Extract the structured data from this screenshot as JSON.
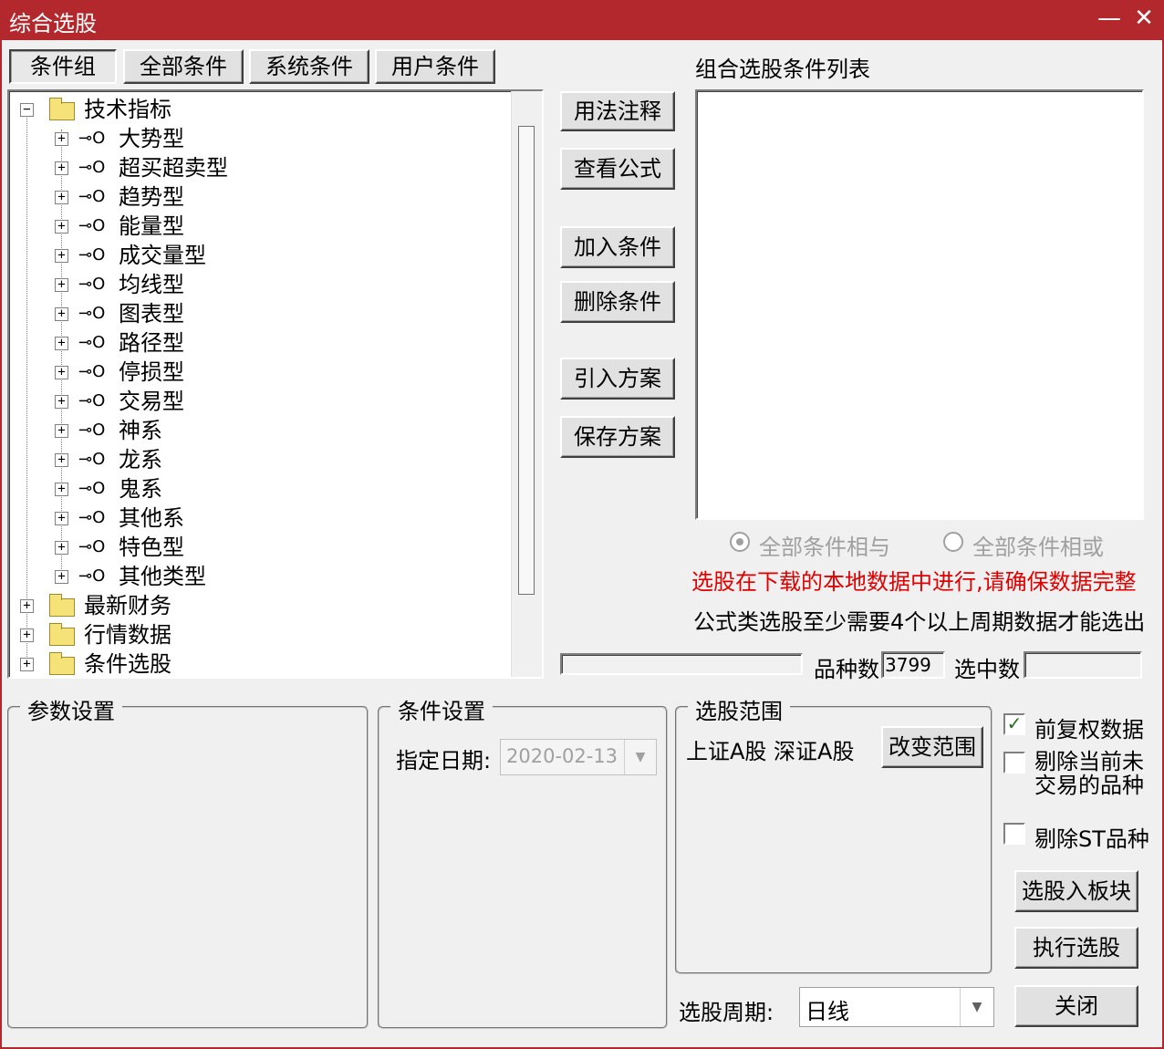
{
  "window": {
    "title": "综合选股",
    "minimize_glyph": "—",
    "close_glyph": "✕"
  },
  "tabs": [
    "条件组",
    "全部条件",
    "系统条件",
    "用户条件"
  ],
  "tree": {
    "root": "技术指标",
    "children": [
      "大势型",
      "超买超卖型",
      "趋势型",
      "能量型",
      "成交量型",
      "均线型",
      "图表型",
      "路径型",
      "停损型",
      "交易型",
      "神系",
      "龙系",
      "鬼系",
      "其他系",
      "特色型",
      "其他类型"
    ],
    "siblings": [
      "最新财务",
      "行情数据",
      "条件选股"
    ]
  },
  "actions": {
    "usage_notes": "用法注释",
    "view_formula": "查看公式",
    "add_condition": "加入条件",
    "delete_condition": "删除条件",
    "import_plan": "引入方案",
    "save_plan": "保存方案"
  },
  "condition_list": {
    "title": "组合选股条件列表"
  },
  "logic": {
    "and_label": "全部条件相与",
    "or_label": "全部条件相或",
    "selected": "and"
  },
  "warning": "选股在下载的本地数据中进行,请确保数据完整",
  "note": "公式类选股至少需要4个以上周期数据才能选出",
  "counts": {
    "variety_label": "品种数",
    "variety_value": "3799",
    "selected_label": "选中数",
    "selected_value": ""
  },
  "param_group": {
    "title": "参数设置"
  },
  "condition_group": {
    "title": "条件设置",
    "date_label": "指定日期:",
    "date_value": "2020-02-13"
  },
  "scope_group": {
    "title": "选股范围",
    "scopes": "上证A股 深证A股",
    "change_button": "改变范围"
  },
  "options": {
    "pre_adjust": {
      "label": "前复权数据",
      "checked": true
    },
    "exclude_untraded": {
      "label": "剔除当前未交易的品种",
      "checked": false
    },
    "exclude_st": {
      "label": "剔除ST品种",
      "checked": false
    }
  },
  "bottom_buttons": {
    "to_block": "选股入板块",
    "execute": "执行选股",
    "close": "关闭"
  },
  "period": {
    "label": "选股周期:",
    "value": "日线"
  },
  "colors": {
    "title_bar": "#b3282d",
    "warning": "#e00000",
    "check": "#207020"
  }
}
